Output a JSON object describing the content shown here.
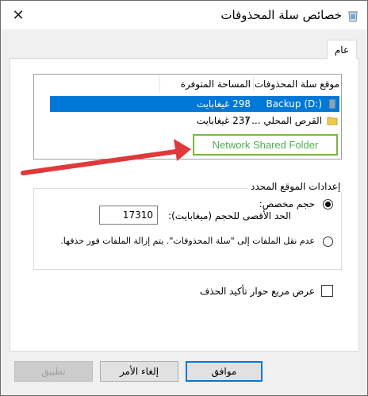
{
  "window": {
    "title": "خصائص سلة المحذوفات",
    "close_glyph": "✕"
  },
  "tabs": [
    {
      "label": "عام"
    }
  ],
  "list": {
    "headers": {
      "location": "موقع سلة المحذوفات",
      "space": "المساحة المتوفرة"
    },
    "rows": [
      {
        "location": "Backup (D:)",
        "space": "298 غيغابايت",
        "selected": true
      },
      {
        "location": "القرص المحلي ... (",
        "space": "237 غيغابايت",
        "selected": false
      }
    ]
  },
  "annotation": {
    "label": "Network Shared Folder",
    "border_color": "#7ab648",
    "text_color": "#4caf50",
    "arrow_color": "#e0393c"
  },
  "settings": {
    "group_title": "إعدادات الموقع المحدد",
    "custom_size_label": "حجم مخصص:",
    "max_size_label": "الحد الأقصى للحجم (ميغابايت):",
    "max_size_value": "17310",
    "no_move_label": "عدم نقل الملفات إلى \"سلة المحذوفات\". يتم إزالة الملفات فور حذفها.",
    "custom_selected": true
  },
  "confirm_dialog_label": "عرض مربع حوار تأكيد الحذف",
  "buttons": {
    "ok": "موافق",
    "cancel": "إلغاء الأمر",
    "apply": "تطبيق"
  },
  "colors": {
    "selection": "#0078d7",
    "default_button_border": "#0078d7"
  }
}
